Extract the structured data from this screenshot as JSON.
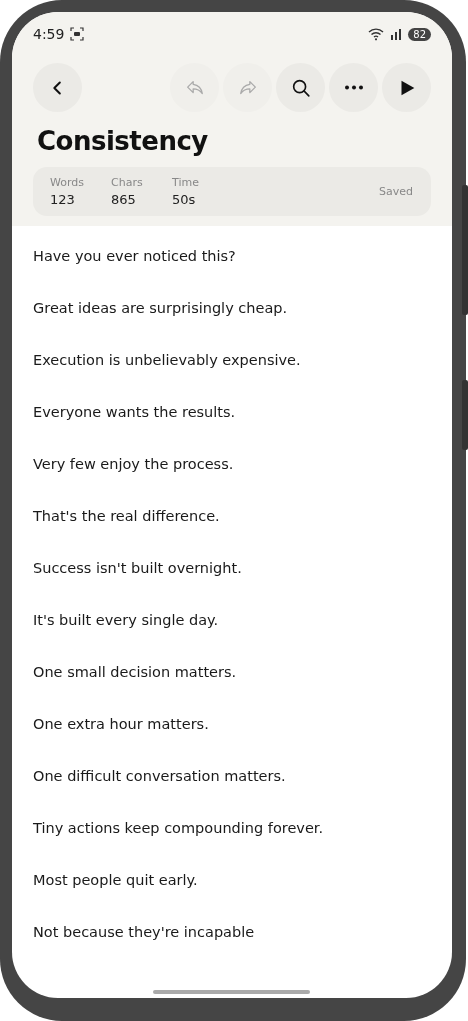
{
  "status_bar": {
    "time": "4:59",
    "battery": "82"
  },
  "toolbar": {
    "buttons": [
      {
        "kind": "back",
        "disabled": false
      },
      {
        "kind": "undo",
        "disabled": true
      },
      {
        "kind": "redo",
        "disabled": true
      },
      {
        "kind": "search",
        "disabled": false
      },
      {
        "kind": "more",
        "disabled": false
      },
      {
        "kind": "play",
        "disabled": false
      }
    ]
  },
  "title": "Consistency",
  "stats": {
    "items": [
      {
        "label": "Words",
        "value": "123"
      },
      {
        "label": "Chars",
        "value": "865"
      },
      {
        "label": "Time",
        "value": "50s"
      }
    ],
    "status": "Saved"
  },
  "lines": [
    "Have you ever noticed this?",
    "Great ideas are surprisingly cheap.",
    "Execution is unbelievably expensive.",
    "Everyone wants the results.",
    "Very few enjoy the process.",
    "That's the real difference.",
    "Success isn't built overnight.",
    "It's built every single day.",
    "One small decision matters.",
    "One extra hour matters.",
    "One difficult conversation matters.",
    "Tiny actions keep compounding forever.",
    "Most people quit early.",
    "Not because they're incapable"
  ]
}
